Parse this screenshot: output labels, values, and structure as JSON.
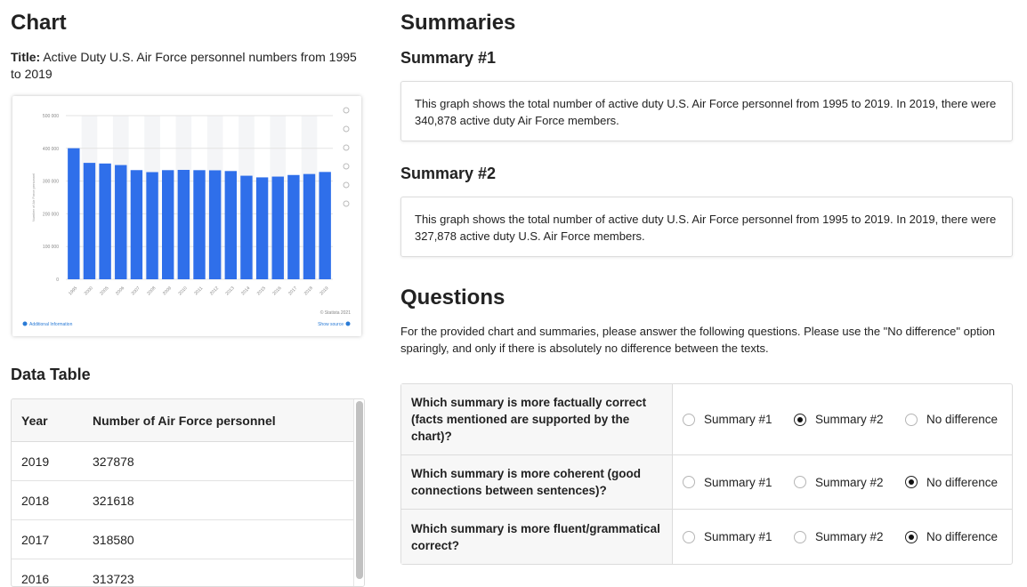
{
  "left": {
    "heading": "Chart",
    "title_label": "Title:",
    "title_text": "Active Duty U.S. Air Force personnel numbers from 1995 to 2019",
    "data_table_heading": "Data Table",
    "table": {
      "headers": [
        "Year",
        "Number of Air Force personnel"
      ],
      "rows": [
        [
          "2019",
          "327878"
        ],
        [
          "2018",
          "321618"
        ],
        [
          "2017",
          "318580"
        ],
        [
          "2016",
          "313723"
        ]
      ]
    }
  },
  "chart_data": {
    "type": "bar",
    "categories": [
      "1995",
      "2000",
      "2005",
      "2006",
      "2007",
      "2008",
      "2009",
      "2010",
      "2011",
      "2012",
      "2013",
      "2014",
      "2015",
      "2016",
      "2017",
      "2018",
      "2019"
    ],
    "values": [
      400409,
      355654,
      353696,
      348953,
      333495,
      327379,
      333408,
      334196,
      333370,
      332959,
      330686,
      316381,
      311357,
      313723,
      318580,
      321618,
      327878
    ],
    "ylim": [
      0,
      500000
    ],
    "yticks": [
      "0",
      "100 000",
      "200 000",
      "300 000",
      "400 000",
      "500 000"
    ],
    "ylabel": "Number of Air Force personnel",
    "xlabel": "",
    "bar_color": "#2f6fea",
    "footer_left": "Additional Information",
    "footer_right": "Show source",
    "credit": "© Statista 2021",
    "grid": true
  },
  "right": {
    "summaries_heading": "Summaries",
    "summary1_heading": "Summary #1",
    "summary1_text": "This graph shows the total number of active duty U.S. Air Force personnel from 1995 to 2019. In 2019, there were 340,878 active duty Air Force members.",
    "summary2_heading": "Summary #2",
    "summary2_text": "This graph shows the total number of active duty U.S. Air Force personnel from 1995 to 2019. In 2019, there were 327,878 active duty U.S. Air Force members.",
    "questions_heading": "Questions",
    "questions_intro": "For the provided chart and summaries, please answer the following questions. Please use the \"No difference\" option sparingly, and only if there is absolutely no difference between the texts.",
    "options": [
      "Summary #1",
      "Summary #2",
      "No difference"
    ],
    "questions": [
      {
        "text": "Which summary is more factually correct (facts mentioned are supported by the chart)?",
        "selected": "Summary #2"
      },
      {
        "text": "Which summary is more coherent (good connections between sentences)?",
        "selected": "No difference"
      },
      {
        "text": "Which summary is more fluent/grammatical correct?",
        "selected": "No difference"
      }
    ]
  }
}
